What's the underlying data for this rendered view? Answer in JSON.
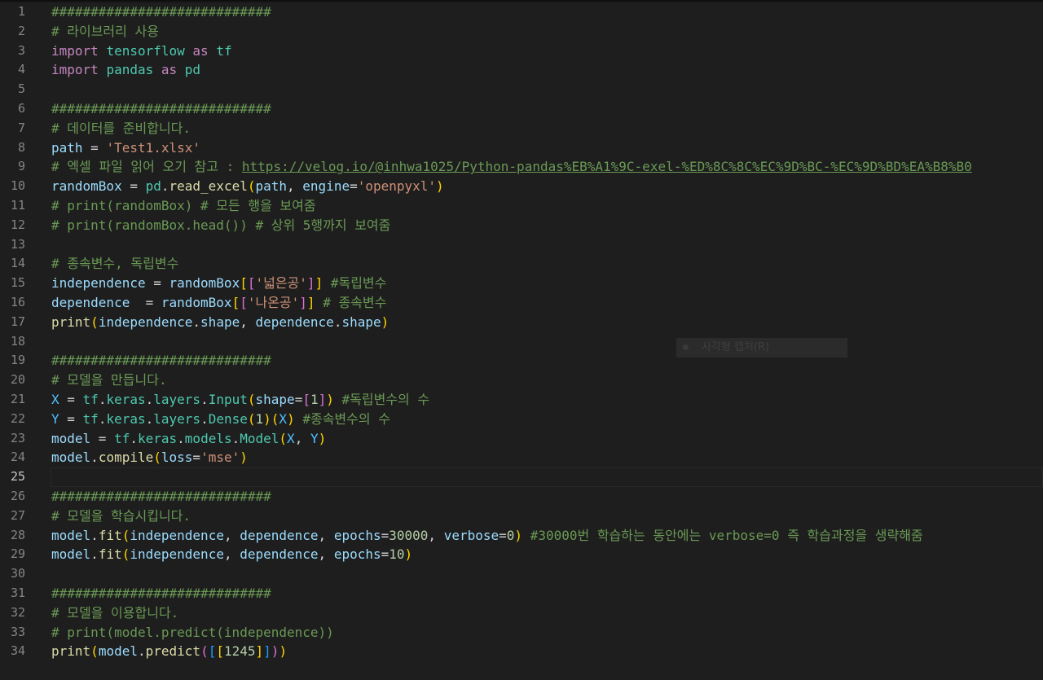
{
  "editor": {
    "current_line": 25,
    "lines": [
      [
        [
          "comment",
          "############################"
        ]
      ],
      [
        [
          "comment",
          "# 라이브러리 사용"
        ]
      ],
      [
        [
          "kw",
          "import"
        ],
        [
          "op",
          " "
        ],
        [
          "mod",
          "tensorflow"
        ],
        [
          "op",
          " "
        ],
        [
          "kw",
          "as"
        ],
        [
          "op",
          " "
        ],
        [
          "mod",
          "tf"
        ]
      ],
      [
        [
          "kw",
          "import"
        ],
        [
          "op",
          " "
        ],
        [
          "mod",
          "pandas"
        ],
        [
          "op",
          " "
        ],
        [
          "kw",
          "as"
        ],
        [
          "op",
          " "
        ],
        [
          "mod",
          "pd"
        ]
      ],
      [],
      [
        [
          "comment",
          "############################"
        ]
      ],
      [
        [
          "comment",
          "# 데이터를 준비합니다."
        ]
      ],
      [
        [
          "var",
          "path"
        ],
        [
          "op",
          " = "
        ],
        [
          "str",
          "'Test1.xlsx'"
        ]
      ],
      [
        [
          "comment",
          "# 엑셀 파일 읽어 오기 참고 : "
        ],
        [
          "link",
          "https://velog.io/@inhwa1025/Python-pandas%EB%A1%9C-exel-%ED%8C%8C%EC%9D%BC-%EC%9D%BD%EA%B8%B0"
        ]
      ],
      [
        [
          "var",
          "randomBox"
        ],
        [
          "op",
          " = "
        ],
        [
          "mod",
          "pd"
        ],
        [
          "op",
          "."
        ],
        [
          "fn",
          "read_excel"
        ],
        [
          "b1",
          "("
        ],
        [
          "var",
          "path"
        ],
        [
          "op",
          ", "
        ],
        [
          "var",
          "engine"
        ],
        [
          "op",
          "="
        ],
        [
          "str",
          "'openpyxl'"
        ],
        [
          "b1",
          ")"
        ]
      ],
      [
        [
          "comment",
          "# print(randomBox) # 모든 행을 보여줌"
        ]
      ],
      [
        [
          "comment",
          "# print(randomBox.head()) # 상위 5행까지 보여줌"
        ]
      ],
      [],
      [
        [
          "comment",
          "# 종속변수, 독립변수"
        ]
      ],
      [
        [
          "var",
          "independence"
        ],
        [
          "op",
          " = "
        ],
        [
          "var",
          "randomBox"
        ],
        [
          "b1",
          "["
        ],
        [
          "b2",
          "["
        ],
        [
          "str",
          "'넓은공'"
        ],
        [
          "b2",
          "]"
        ],
        [
          "b1",
          "]"
        ],
        [
          "op",
          " "
        ],
        [
          "comment",
          "#독립변수"
        ]
      ],
      [
        [
          "var",
          "dependence"
        ],
        [
          "op",
          "  = "
        ],
        [
          "var",
          "randomBox"
        ],
        [
          "b1",
          "["
        ],
        [
          "b2",
          "["
        ],
        [
          "str",
          "'나온공'"
        ],
        [
          "b2",
          "]"
        ],
        [
          "b1",
          "]"
        ],
        [
          "op",
          " "
        ],
        [
          "comment",
          "# 종속변수"
        ]
      ],
      [
        [
          "fn",
          "print"
        ],
        [
          "b1",
          "("
        ],
        [
          "var",
          "independence"
        ],
        [
          "op",
          "."
        ],
        [
          "var",
          "shape"
        ],
        [
          "op",
          ", "
        ],
        [
          "var",
          "dependence"
        ],
        [
          "op",
          "."
        ],
        [
          "var",
          "shape"
        ],
        [
          "b1",
          ")"
        ]
      ],
      [],
      [
        [
          "comment",
          "############################"
        ]
      ],
      [
        [
          "comment",
          "# 모델을 만듭니다."
        ]
      ],
      [
        [
          "const",
          "X"
        ],
        [
          "op",
          " = "
        ],
        [
          "mod",
          "tf"
        ],
        [
          "op",
          "."
        ],
        [
          "mod",
          "keras"
        ],
        [
          "op",
          "."
        ],
        [
          "mod",
          "layers"
        ],
        [
          "op",
          "."
        ],
        [
          "mod",
          "Input"
        ],
        [
          "b1",
          "("
        ],
        [
          "var",
          "shape"
        ],
        [
          "op",
          "="
        ],
        [
          "b2",
          "["
        ],
        [
          "num",
          "1"
        ],
        [
          "b2",
          "]"
        ],
        [
          "b1",
          ")"
        ],
        [
          "op",
          " "
        ],
        [
          "comment",
          "#독립변수의 수"
        ]
      ],
      [
        [
          "const",
          "Y"
        ],
        [
          "op",
          " = "
        ],
        [
          "mod",
          "tf"
        ],
        [
          "op",
          "."
        ],
        [
          "mod",
          "keras"
        ],
        [
          "op",
          "."
        ],
        [
          "mod",
          "layers"
        ],
        [
          "op",
          "."
        ],
        [
          "mod",
          "Dense"
        ],
        [
          "b1",
          "("
        ],
        [
          "num",
          "1"
        ],
        [
          "b1",
          ")("
        ],
        [
          "const",
          "X"
        ],
        [
          "b1",
          ")"
        ],
        [
          "op",
          " "
        ],
        [
          "comment",
          "#종속변수의 수"
        ]
      ],
      [
        [
          "var",
          "model"
        ],
        [
          "op",
          " = "
        ],
        [
          "mod",
          "tf"
        ],
        [
          "op",
          "."
        ],
        [
          "mod",
          "keras"
        ],
        [
          "op",
          "."
        ],
        [
          "mod",
          "models"
        ],
        [
          "op",
          "."
        ],
        [
          "mod",
          "Model"
        ],
        [
          "b1",
          "("
        ],
        [
          "const",
          "X"
        ],
        [
          "op",
          ", "
        ],
        [
          "const",
          "Y"
        ],
        [
          "b1",
          ")"
        ]
      ],
      [
        [
          "var",
          "model"
        ],
        [
          "op",
          "."
        ],
        [
          "fn",
          "compile"
        ],
        [
          "b1",
          "("
        ],
        [
          "var",
          "loss"
        ],
        [
          "op",
          "="
        ],
        [
          "str",
          "'mse'"
        ],
        [
          "b1",
          ")"
        ]
      ],
      [],
      [
        [
          "comment",
          "############################"
        ]
      ],
      [
        [
          "comment",
          "# 모델을 학습시킵니다."
        ]
      ],
      [
        [
          "var",
          "model"
        ],
        [
          "op",
          "."
        ],
        [
          "fn",
          "fit"
        ],
        [
          "b1",
          "("
        ],
        [
          "var",
          "independence"
        ],
        [
          "op",
          ", "
        ],
        [
          "var",
          "dependence"
        ],
        [
          "op",
          ", "
        ],
        [
          "var",
          "epochs"
        ],
        [
          "op",
          "="
        ],
        [
          "num",
          "30000"
        ],
        [
          "op",
          ", "
        ],
        [
          "var",
          "verbose"
        ],
        [
          "op",
          "="
        ],
        [
          "num",
          "0"
        ],
        [
          "b1",
          ")"
        ],
        [
          "op",
          " "
        ],
        [
          "comment",
          "#30000번 학습하는 동안에는 verbose=0 즉 학습과정을 생략해줌"
        ]
      ],
      [
        [
          "var",
          "model"
        ],
        [
          "op",
          "."
        ],
        [
          "fn",
          "fit"
        ],
        [
          "b1",
          "("
        ],
        [
          "var",
          "independence"
        ],
        [
          "op",
          ", "
        ],
        [
          "var",
          "dependence"
        ],
        [
          "op",
          ", "
        ],
        [
          "var",
          "epochs"
        ],
        [
          "op",
          "="
        ],
        [
          "num",
          "10"
        ],
        [
          "b1",
          ")"
        ]
      ],
      [],
      [
        [
          "comment",
          "############################"
        ]
      ],
      [
        [
          "comment",
          "# 모델을 이용합니다."
        ]
      ],
      [
        [
          "comment",
          "# print(model.predict(independence))"
        ]
      ],
      [
        [
          "fn",
          "print"
        ],
        [
          "b1",
          "("
        ],
        [
          "var",
          "model"
        ],
        [
          "op",
          "."
        ],
        [
          "fn",
          "predict"
        ],
        [
          "b2",
          "("
        ],
        [
          "b3",
          "["
        ],
        [
          "b1",
          "["
        ],
        [
          "num",
          "1245"
        ],
        [
          "b1",
          "]"
        ],
        [
          "b3",
          "]"
        ],
        [
          "b2",
          ")"
        ],
        [
          "b1",
          ")"
        ]
      ]
    ]
  },
  "tooltip": {
    "label": "사각형 캡처(R)",
    "icon": "dot-icon"
  }
}
